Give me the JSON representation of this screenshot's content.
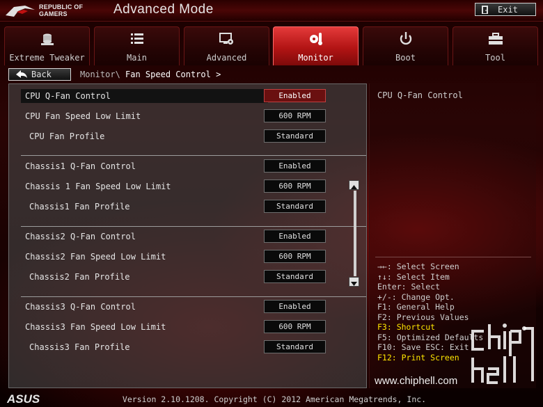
{
  "header": {
    "brand_line1": "REPUBLIC OF",
    "brand_line2": "GAMERS",
    "mode_title": "Advanced Mode",
    "exit_label": "Exit"
  },
  "tabs": [
    {
      "label": "Extreme Tweaker",
      "icon": "tweaker-icon",
      "active": false
    },
    {
      "label": "Main",
      "icon": "list-icon",
      "active": false
    },
    {
      "label": "Advanced",
      "icon": "advanced-icon",
      "active": false
    },
    {
      "label": "Monitor",
      "icon": "monitor-icon",
      "active": true
    },
    {
      "label": "Boot",
      "icon": "power-icon",
      "active": false
    },
    {
      "label": "Tool",
      "icon": "toolbox-icon",
      "active": false
    }
  ],
  "nav": {
    "back_label": "Back",
    "breadcrumb_parent": "Monitor\\",
    "breadcrumb_current": "Fan Speed Control >"
  },
  "settings": [
    {
      "label": "CPU Q-Fan Control",
      "value": "Enabled",
      "indent": false,
      "selected": true
    },
    {
      "label": "CPU Fan Speed Low Limit",
      "value": "600 RPM",
      "indent": false,
      "selected": false
    },
    {
      "label": "CPU Fan Profile",
      "value": "Standard",
      "indent": true,
      "selected": false
    },
    {
      "label": "Chassis1 Q-Fan Control",
      "value": "Enabled",
      "indent": false,
      "selected": false
    },
    {
      "label": "Chassis 1 Fan Speed Low Limit",
      "value": "600 RPM",
      "indent": false,
      "selected": false
    },
    {
      "label": "Chassis1 Fan Profile",
      "value": "Standard",
      "indent": true,
      "selected": false
    },
    {
      "label": "Chassis2 Q-Fan Control",
      "value": "Enabled",
      "indent": false,
      "selected": false
    },
    {
      "label": "Chassis2 Fan Speed Low Limit",
      "value": "600 RPM",
      "indent": false,
      "selected": false
    },
    {
      "label": "Chassis2 Fan Profile",
      "value": "Standard",
      "indent": true,
      "selected": false
    },
    {
      "label": "Chassis3 Q-Fan Control",
      "value": "Enabled",
      "indent": false,
      "selected": false
    },
    {
      "label": "Chassis3 Fan Speed Low Limit",
      "value": "600 RPM",
      "indent": false,
      "selected": false
    },
    {
      "label": "Chassis3 Fan Profile",
      "value": "Standard",
      "indent": true,
      "selected": false
    }
  ],
  "help": {
    "title": "CPU Q-Fan Control",
    "keys": [
      {
        "text": "→←: Select Screen",
        "highlight": false
      },
      {
        "text": "↑↓: Select Item",
        "highlight": false
      },
      {
        "text": "Enter: Select",
        "highlight": false
      },
      {
        "text": "+/-: Change Opt.",
        "highlight": false
      },
      {
        "text": "F1: General Help",
        "highlight": false
      },
      {
        "text": "F2: Previous Values",
        "highlight": false
      },
      {
        "text": "F3: Shortcut",
        "highlight": true
      },
      {
        "text": "F5: Optimized Defaults",
        "highlight": false
      },
      {
        "text": "F10: Save  ESC: Exit",
        "highlight": false
      },
      {
        "text": "F12: Print Screen",
        "highlight": true
      }
    ]
  },
  "watermark": {
    "text": "www.chiphell.com",
    "logo_icon": "chiphell-logo"
  },
  "footer": {
    "brand": "ASUS",
    "version": "Version 2.10.1208. Copyright (C) 2012 American Megatrends, Inc."
  },
  "colors": {
    "accent": "#c81818",
    "highlight_key": "#ffe600",
    "selected_value_bg": "#6a1010"
  }
}
